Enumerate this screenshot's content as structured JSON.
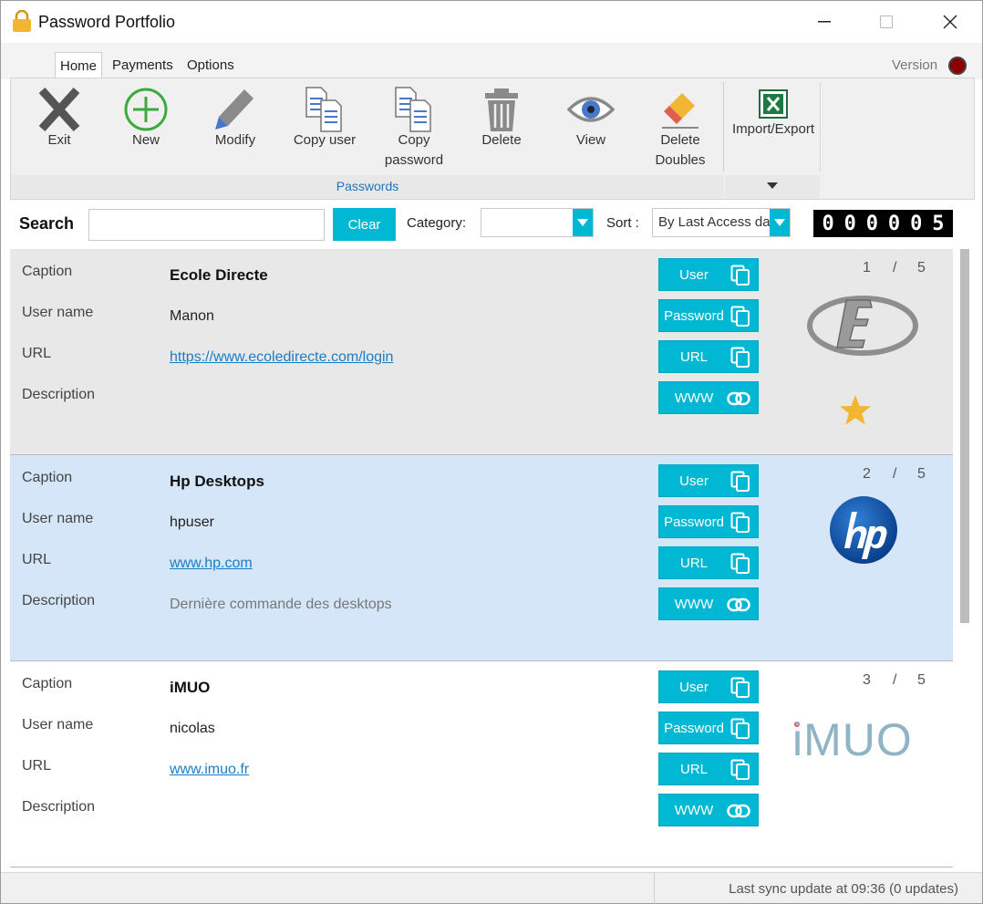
{
  "window": {
    "title": "Password Portfolio"
  },
  "tabs": [
    {
      "label": "Home",
      "active": true
    },
    {
      "label": "Payments",
      "active": false
    },
    {
      "label": "Options",
      "active": false
    }
  ],
  "version_label": "Version",
  "ribbon": {
    "buttons": [
      {
        "label": "Exit",
        "icon": "exit-x-icon"
      },
      {
        "label": "New",
        "icon": "plus-circle-icon"
      },
      {
        "label": "Modify",
        "icon": "pencil-icon"
      },
      {
        "label": "Copy user",
        "icon": "copy-documents-icon"
      },
      {
        "label": "Copy password",
        "icon": "copy-documents-icon"
      },
      {
        "label": "Delete",
        "icon": "trash-icon"
      },
      {
        "label": "View",
        "icon": "eye-icon"
      },
      {
        "label": "Delete Doubles",
        "icon": "eraser-icon"
      },
      {
        "label": "Import/Export",
        "icon": "excel-icon"
      }
    ],
    "group_label": "Passwords"
  },
  "search": {
    "label": "Search",
    "value": "",
    "clear_label": "Clear",
    "category_label": "Category:",
    "category_value": "",
    "sort_label": "Sort :",
    "sort_value": "By Last Access da",
    "counter_digits": [
      "0",
      "0",
      "0",
      "0",
      "0",
      "5"
    ]
  },
  "labels": {
    "caption": "Caption",
    "username": "User name",
    "url": "URL",
    "description": "Description",
    "btn_user": "User",
    "btn_password": "Password",
    "btn_url": "URL",
    "btn_www": "WWW",
    "index_sep": "/"
  },
  "entries": [
    {
      "caption": "Ecole Directe",
      "username": "Manon",
      "url": "https://www.ecoledirecte.com/login",
      "description": "",
      "index": "1",
      "total": "5",
      "logo": "ecole-directe-logo",
      "favorite": true,
      "background": "#e8e8e8"
    },
    {
      "caption": "Hp Desktops",
      "username": "hpuser",
      "url": "www.hp.com",
      "description": "Dernière commande des desktops",
      "index": "2",
      "total": "5",
      "logo": "hp-logo",
      "favorite": false,
      "background": "#d5e6f8"
    },
    {
      "caption": "iMUO",
      "username": "nicolas",
      "url": "www.imuo.fr",
      "description": "",
      "index": "3",
      "total": "5",
      "logo": "imuo-logo",
      "logo_text": "iMUO",
      "favorite": false,
      "background": "#ffffff"
    }
  ],
  "status": {
    "text": "Last sync update at 09:36 (0 updates)"
  },
  "colors": {
    "accent": "#00b7d4",
    "link": "#1a7dc4",
    "selected_row": "#d5e6f8",
    "first_row": "#e8e8e8",
    "star": "#f2b632"
  }
}
